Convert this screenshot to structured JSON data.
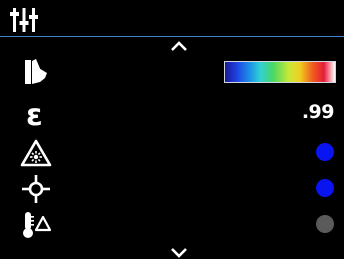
{
  "header": {
    "icon": "settings-sliders-icon"
  },
  "navigation": {
    "up_icon": "chevron-up-icon",
    "down_icon": "chevron-down-icon"
  },
  "rows": [
    {
      "icon": "color-palette-icon",
      "control": "palette-gradient",
      "gradient": [
        "#1a1a8f",
        "#1d3fe0",
        "#1d8ee8",
        "#2fd0d6",
        "#4bd862",
        "#c8e83a",
        "#f0d020",
        "#ef5a1e",
        "#e61c3a",
        "#ffffff"
      ]
    },
    {
      "icon": "emissivity-icon",
      "glyph": "ε",
      "value": ".99"
    },
    {
      "icon": "laser-warning-icon",
      "state_color": "#0a14f0"
    },
    {
      "icon": "crosshair-icon",
      "state_color": "#0a14f0"
    },
    {
      "icon": "temperature-alarm-icon",
      "state_color": "#5a5a5a"
    }
  ],
  "colors": {
    "background": "#000000",
    "header_rule": "#3a86c8",
    "icon": "#ffffff",
    "active_dot": "#0a14f0",
    "inactive_dot": "#5a5a5a"
  }
}
